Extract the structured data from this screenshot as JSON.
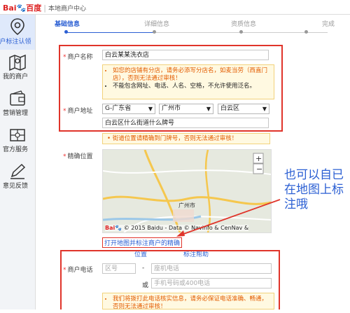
{
  "header": {
    "logo_text": "Bai",
    "logo_tail": "百度",
    "title": "本地商户中心"
  },
  "sidebar": {
    "items": [
      {
        "label": "户标注认领",
        "icon": "location-pin-icon",
        "active": true
      },
      {
        "label": "我的商户",
        "icon": "map-icon"
      },
      {
        "label": "营销管理",
        "icon": "wallet-icon"
      },
      {
        "label": "官方服务",
        "icon": "service-card-icon"
      },
      {
        "label": "意见反馈",
        "icon": "pencil-icon"
      }
    ]
  },
  "steps": [
    "基础信息",
    "详细信息",
    "资质信息",
    "完成"
  ],
  "form": {
    "name_label": "商户名称",
    "name_value": "白云某某洗衣店",
    "name_hint_1": "如您的店铺有分店，请务必添写分店名，如麦当劳（西直门店），否则无法通过审核！",
    "name_hint_2": "不能包含网址、电话、人名、空格，不允许使用泛名。",
    "address_label": "商户地址",
    "province": "G-广东省",
    "city": "广州市",
    "district": "白云区",
    "street_value": "白云区什么街道什么牌号",
    "address_hint": "街道位置请精确到门牌号，否则无法通过审核！",
    "location_label": "精确位置",
    "map_copyright": "© 2015 Baidu - Data © Navinfo & CenNav &",
    "map_logo": "Bai",
    "map_city_label": "广州市",
    "open_map_link": "打开地图并标注商户的精确",
    "location_sub": "位置",
    "help_link": "标注帮助",
    "phone_label": "商户电话",
    "area_code_placeholder": "区号",
    "dash": "-",
    "landline_placeholder": "座机电话",
    "or_label": "或",
    "mobile_placeholder": "手机号码或400电话",
    "phone_hint": "我们将拨打此电话核实信息，请务必保证电话准确、畅通，否则无法通过审核！"
  },
  "annotation": "也可以自已在地图上标注哦",
  "colors": {
    "accent": "#2b5fd3",
    "highlight": "#e0342a",
    "hint_bg": "#fff9e1",
    "hint_text": "#e35c00"
  }
}
